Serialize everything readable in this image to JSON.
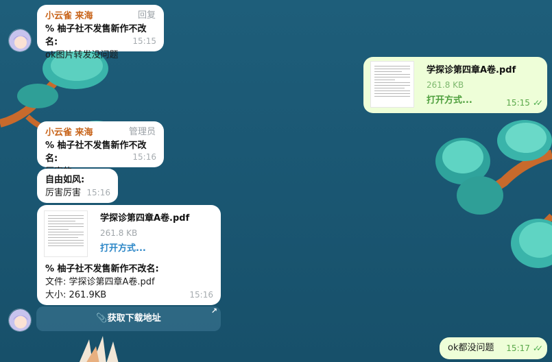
{
  "messages": [
    {
      "sender": "小云雀 来海",
      "role": "回复",
      "quote": "% 柚子社不发售新作不改名:",
      "text": "ok图片转发没问题",
      "time": "15:15"
    },
    {
      "sender": "小云雀 来海",
      "role": "管理员",
      "quote": "% 柚子社不发售新作不改名:",
      "text": "厉害的",
      "time": "15:16"
    },
    {
      "quote": "自由如风:",
      "text": "厉害厉害",
      "time": "15:16"
    },
    {
      "file": {
        "name": "学探诊第四章A卷.pdf",
        "size": "261.8 KB",
        "open": "打开方式..."
      },
      "quote": "% 柚子社不发售新作不改名:",
      "lines": [
        "文件: 学探诊第四章A卷.pdf",
        "大小: 261.9KB"
      ],
      "time": "15:16",
      "button": {
        "icon": "paperclip-icon",
        "label": "获取下载地址",
        "arrow": "↗"
      }
    }
  ],
  "outgoing": [
    {
      "file": {
        "name": "学探诊第四章A卷.pdf",
        "size": "261.8 KB",
        "open": "打开方式..."
      },
      "time": "15:15",
      "ticks": "✓✓"
    },
    {
      "text": "ok都没问题",
      "time": "15:17",
      "ticks": "✓✓"
    }
  ],
  "colors": {
    "background": "#1b5874",
    "sender": "#c8641a",
    "link_in": "#2d87c7",
    "link_out": "#4e9f3d",
    "outgoing_bubble": "#eefed8"
  }
}
